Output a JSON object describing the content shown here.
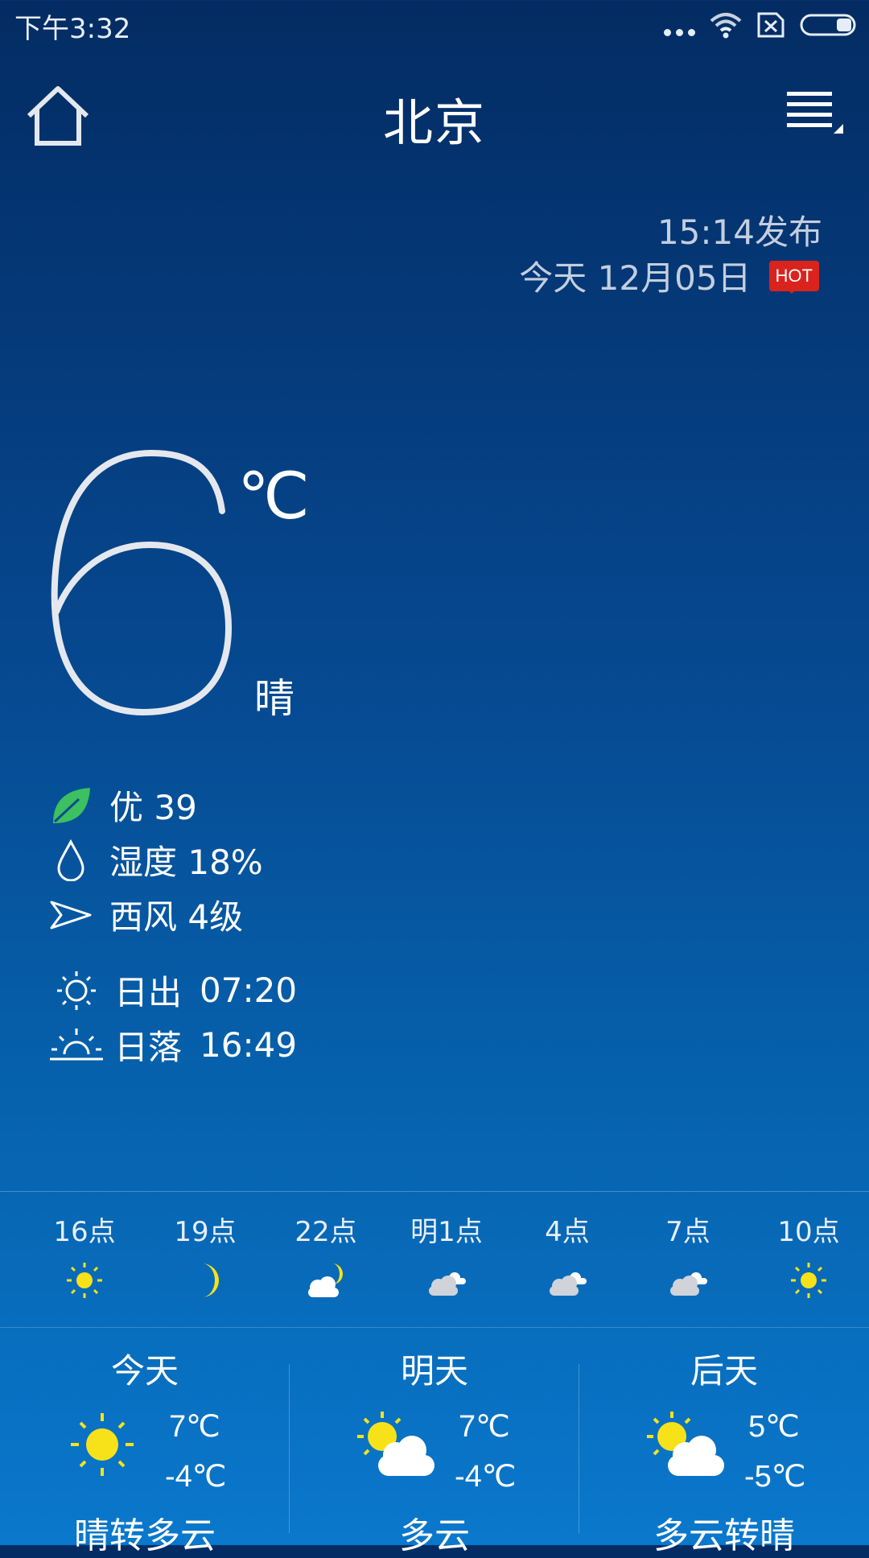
{
  "status_bar": {
    "time": "下午3:32",
    "icons": [
      "more-dots-icon",
      "wifi-icon",
      "sim-x-icon",
      "battery-icon"
    ]
  },
  "header": {
    "city": "北京",
    "home_icon": "home-icon",
    "menu_icon": "menu-icon"
  },
  "publish": {
    "time": "15:14发布",
    "date": "今天 12月05日",
    "badge": "HOT"
  },
  "current": {
    "temperature": "6",
    "unit": "℃",
    "condition": "晴"
  },
  "details": {
    "aqi": "优 39",
    "humidity": "湿度 18%",
    "wind": "西风 4级"
  },
  "sun": {
    "sunrise_label": "日出",
    "sunrise_time": "07:20",
    "sunset_label": "日落",
    "sunset_time": "16:49"
  },
  "hourly": [
    {
      "label": "16点",
      "icon": "sun-icon"
    },
    {
      "label": "19点",
      "icon": "moon-icon"
    },
    {
      "label": "22点",
      "icon": "moon-cloud-icon"
    },
    {
      "label": "明1点",
      "icon": "cloud-icon"
    },
    {
      "label": "4点",
      "icon": "cloud-icon"
    },
    {
      "label": "7点",
      "icon": "cloud-icon"
    },
    {
      "label": "10点",
      "icon": "sun-icon"
    }
  ],
  "daily": [
    {
      "label": "今天",
      "high": "7℃",
      "low": "-4℃",
      "condition": "晴转多云",
      "icon": "sun-icon"
    },
    {
      "label": "明天",
      "high": "7℃",
      "low": "-4℃",
      "condition": "多云",
      "icon": "sun-cloud-icon"
    },
    {
      "label": "后天",
      "high": "5℃",
      "low": "-5℃",
      "condition": "多云转晴",
      "icon": "sun-cloud-icon"
    }
  ],
  "colors": {
    "sun": "#f7e21a",
    "cloud": "#d0d3d9",
    "leaf": "#3cc060",
    "hot_badge": "#d9231c"
  }
}
